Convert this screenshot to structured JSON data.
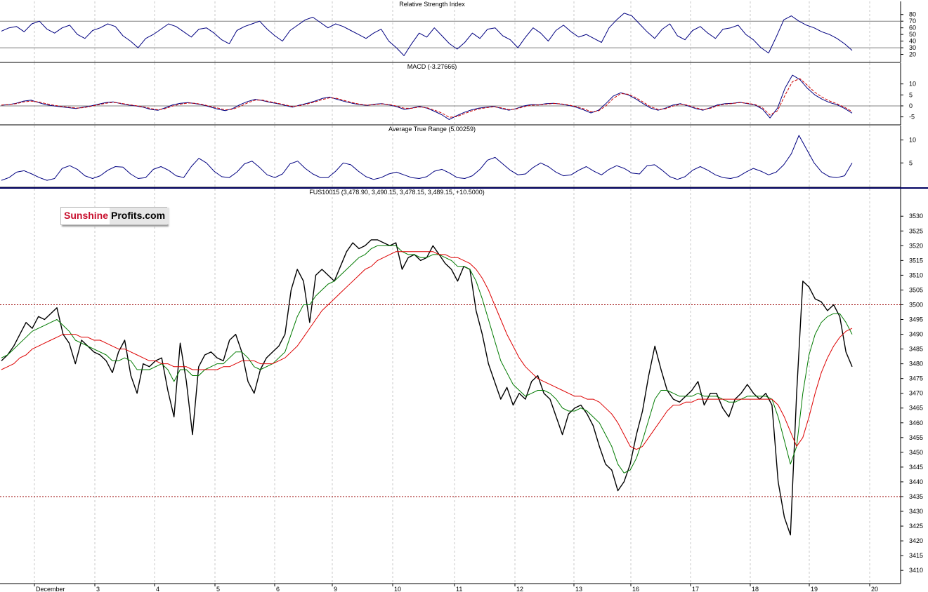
{
  "logo": {
    "part1": "Sunshine",
    "part2": "Profits.com"
  },
  "chart_data": [
    {
      "type": "line",
      "title": "Relative Strength Index",
      "ylim": [
        10,
        85
      ],
      "yticks": [
        80,
        70,
        60,
        50,
        40,
        30,
        20
      ],
      "reference_lines": [
        30,
        70
      ],
      "series": [
        {
          "name": "",
          "color": "#000080",
          "values": [
            55,
            60,
            62,
            54,
            66,
            70,
            58,
            52,
            60,
            64,
            50,
            44,
            56,
            60,
            66,
            62,
            48,
            40,
            30,
            44,
            50,
            58,
            66,
            62,
            54,
            46,
            58,
            60,
            52,
            42,
            36,
            56,
            62,
            66,
            70,
            58,
            48,
            40,
            56,
            64,
            72,
            76,
            68,
            60,
            66,
            62,
            56,
            50,
            44,
            52,
            58,
            40,
            30,
            18,
            36,
            52,
            46,
            60,
            48,
            36,
            28,
            38,
            52,
            44,
            58,
            60,
            48,
            42,
            30,
            46,
            60,
            52,
            40,
            56,
            64,
            54,
            46,
            50,
            44,
            38,
            60,
            72,
            82,
            78,
            66,
            54,
            44,
            58,
            66,
            48,
            42,
            56,
            62,
            52,
            44,
            58,
            60,
            64,
            50,
            42,
            30,
            22,
            46,
            72,
            78,
            70,
            64,
            60,
            54,
            50,
            44,
            36,
            26
          ]
        }
      ]
    },
    {
      "type": "line",
      "title": "MACD (-3.27666)",
      "ylim": [
        -8,
        15
      ],
      "yticks": [
        10,
        5,
        0,
        -5
      ],
      "reference_lines": [
        0
      ],
      "series": [
        {
          "name": "",
          "color": "#000080",
          "values": [
            0.3,
            0.6,
            1.2,
            2.2,
            2.6,
            1.5,
            0.5,
            0,
            -0.4,
            -0.8,
            -1.2,
            -0.6,
            0,
            0.8,
            1.5,
            1.8,
            1.0,
            0.4,
            0,
            -0.6,
            -1.6,
            -2.0,
            -0.8,
            0.5,
            1.2,
            1.5,
            1.0,
            0.4,
            -0.5,
            -1.5,
            -2.2,
            -1.2,
            0.6,
            2.0,
            3.0,
            2.4,
            1.6,
            1.0,
            0.2,
            -0.6,
            0.4,
            1.2,
            2.2,
            3.4,
            4.0,
            3.0,
            2.0,
            1.2,
            0.6,
            0.2,
            0.8,
            1.0,
            0.4,
            -0.4,
            -1.6,
            -1.0,
            -0.2,
            -1.0,
            -2.4,
            -4.0,
            -6.2,
            -4.5,
            -3.0,
            -1.8,
            -1.0,
            -0.6,
            -0.2,
            -1.2,
            -2.0,
            -1.2,
            0,
            0.6,
            0.5,
            1.0,
            1.2,
            0.8,
            0.2,
            -0.6,
            -1.8,
            -3.2,
            -2.0,
            1.0,
            4.5,
            6.0,
            5.0,
            3.2,
            1.0,
            -1.0,
            -2.0,
            -1.0,
            0.4,
            1.0,
            0,
            -1.2,
            -2.0,
            -0.8,
            0.5,
            1.0,
            1.2,
            1.6,
            1.0,
            0.4,
            -1.5,
            -5.5,
            -1.0,
            8.0,
            14.0,
            12.0,
            8.0,
            5.0,
            3.0,
            1.5,
            0.5,
            -1.2,
            -3.3
          ]
        },
        {
          "name": "",
          "color": "#cc0000",
          "values": [
            0.4,
            0.6,
            1.0,
            1.8,
            2.2,
            1.8,
            1.0,
            0.3,
            -0.2,
            -0.6,
            -1.0,
            -0.8,
            -0.2,
            0.5,
            1.2,
            1.6,
            1.2,
            0.6,
            0.1,
            -0.4,
            -1.2,
            -1.8,
            -1.2,
            0.0,
            0.8,
            1.3,
            1.2,
            0.6,
            -0.2,
            -1.0,
            -1.8,
            -1.5,
            -0.2,
            1.4,
            2.6,
            2.6,
            1.9,
            1.2,
            0.5,
            -0.3,
            0.1,
            0.9,
            1.8,
            2.9,
            3.7,
            3.4,
            2.4,
            1.5,
            0.8,
            0.3,
            0.6,
            0.9,
            0.6,
            -0.1,
            -1.1,
            -1.1,
            -0.5,
            -0.8,
            -1.9,
            -3.2,
            -5.2,
            -4.9,
            -3.6,
            -2.3,
            -1.4,
            -0.8,
            -0.4,
            -0.9,
            -1.7,
            -1.4,
            -0.4,
            0.3,
            0.4,
            0.8,
            1.1,
            0.9,
            0.4,
            -0.3,
            -1.3,
            -2.6,
            -2.3,
            0.0,
            3.4,
            5.6,
            5.3,
            3.8,
            1.7,
            -0.4,
            -1.6,
            -1.3,
            -0.1,
            0.8,
            0.3,
            -0.8,
            -1.7,
            -1.1,
            0.1,
            0.8,
            1.1,
            1.5,
            1.2,
            0.6,
            -0.9,
            -4.2,
            -2.2,
            4.8,
            11.0,
            12.4,
            9.4,
            6.2,
            3.9,
            2.2,
            0.9,
            -0.7,
            -2.6
          ]
        }
      ]
    },
    {
      "type": "line",
      "title": "Average True Range (5.00259)",
      "ylim": [
        0,
        11
      ],
      "yticks": [
        10,
        5
      ],
      "series": [
        {
          "name": "",
          "color": "#000080",
          "values": [
            1.2,
            1.8,
            3.0,
            3.3,
            2.6,
            1.8,
            1.2,
            1.6,
            3.8,
            4.4,
            3.6,
            2.2,
            1.6,
            2.2,
            3.4,
            4.2,
            4.1,
            2.6,
            1.6,
            1.8,
            3.6,
            4.2,
            3.4,
            2.2,
            1.8,
            4.2,
            6.0,
            5.0,
            3.2,
            2.0,
            1.8,
            3.0,
            4.8,
            5.4,
            4.0,
            2.4,
            1.8,
            2.6,
            4.8,
            5.4,
            3.8,
            2.6,
            1.8,
            1.8,
            3.2,
            5.0,
            4.6,
            3.2,
            2.0,
            1.4,
            1.8,
            2.6,
            3.0,
            2.4,
            1.8,
            1.6,
            2.0,
            3.2,
            3.6,
            2.8,
            1.8,
            1.6,
            2.2,
            3.6,
            5.6,
            6.2,
            4.8,
            3.4,
            2.4,
            2.6,
            4.0,
            5.0,
            4.2,
            3.0,
            2.2,
            2.4,
            3.4,
            4.2,
            3.2,
            2.4,
            3.6,
            4.4,
            3.8,
            2.8,
            2.6,
            4.4,
            4.6,
            3.4,
            2.0,
            1.4,
            2.0,
            3.4,
            4.2,
            3.4,
            2.4,
            1.8,
            1.6,
            2.0,
            3.0,
            3.8,
            3.2,
            2.4,
            3.0,
            4.6,
            7.0,
            11.0,
            8.0,
            5.0,
            3.0,
            2.0,
            1.8,
            2.2,
            5.0
          ]
        }
      ]
    },
    {
      "type": "line",
      "title": "FUS10015 (3,478.90, 3,490.15, 3,478.15, 3,489.15, +10.5000)",
      "ylim": [
        3406,
        3536
      ],
      "yticks": [
        3530,
        3525,
        3520,
        3515,
        3510,
        3505,
        3500,
        3495,
        3490,
        3485,
        3480,
        3475,
        3470,
        3465,
        3460,
        3455,
        3450,
        3445,
        3440,
        3435,
        3430,
        3425,
        3420,
        3415,
        3410
      ],
      "reference_lines": [
        3500,
        3435
      ],
      "x_labels": [
        "December",
        "3",
        "4",
        "5",
        "6",
        "9",
        "10",
        "11",
        "12",
        "13",
        "16",
        "17",
        "18",
        "19",
        "20"
      ],
      "series": [
        {
          "name": "",
          "color": "#000000",
          "values": [
            3481,
            3483,
            3486,
            3490,
            3494,
            3492,
            3496,
            3495,
            3497,
            3499,
            3490,
            3487,
            3480,
            3488,
            3486,
            3484,
            3483,
            3481,
            3477,
            3484,
            3488,
            3476,
            3470,
            3480,
            3479,
            3481,
            3482,
            3471,
            3462,
            3487,
            3474,
            3456,
            3479,
            3483,
            3484,
            3482,
            3481,
            3488,
            3490,
            3484,
            3474,
            3470,
            3478,
            3482,
            3484,
            3486,
            3490,
            3505,
            3512,
            3508,
            3494,
            3510,
            3512,
            3510,
            3508,
            3513,
            3518,
            3521,
            3519,
            3520,
            3522,
            3522,
            3521,
            3520,
            3521,
            3512,
            3516,
            3517,
            3515,
            3516,
            3520,
            3517,
            3514,
            3512,
            3508,
            3513,
            3512,
            3498,
            3490,
            3480,
            3474,
            3468,
            3472,
            3466,
            3470,
            3468,
            3474,
            3476,
            3470,
            3468,
            3462,
            3456,
            3463,
            3465,
            3466,
            3463,
            3459,
            3452,
            3446,
            3444,
            3437,
            3440,
            3446,
            3456,
            3464,
            3476,
            3486,
            3478,
            3471,
            3468,
            3467,
            3469,
            3471,
            3474,
            3466,
            3470,
            3470,
            3465,
            3462,
            3468,
            3470,
            3473,
            3470,
            3468,
            3470,
            3466,
            3440,
            3428,
            3422,
            3470,
            3508,
            3506,
            3502,
            3501,
            3498,
            3500,
            3496,
            3484,
            3479
          ]
        },
        {
          "name": "",
          "color": "#007a00",
          "values": [
            3482,
            3483,
            3485,
            3487,
            3489,
            3491,
            3492,
            3493,
            3494,
            3495,
            3493,
            3491,
            3488,
            3487,
            3486,
            3485,
            3484,
            3483,
            3481,
            3481,
            3482,
            3481,
            3478,
            3478,
            3478,
            3479,
            3480,
            3478,
            3474,
            3478,
            3478,
            3476,
            3476,
            3478,
            3479,
            3480,
            3480,
            3482,
            3484,
            3484,
            3482,
            3479,
            3478,
            3479,
            3480,
            3482,
            3484,
            3490,
            3496,
            3500,
            3500,
            3503,
            3505,
            3507,
            3508,
            3510,
            3512,
            3514,
            3516,
            3517,
            3519,
            3520,
            3520,
            3520,
            3520,
            3518,
            3517,
            3517,
            3516,
            3516,
            3517,
            3517,
            3516,
            3515,
            3513,
            3513,
            3512,
            3508,
            3502,
            3495,
            3488,
            3481,
            3477,
            3473,
            3471,
            3469,
            3470,
            3471,
            3471,
            3470,
            3468,
            3465,
            3464,
            3464,
            3465,
            3464,
            3462,
            3460,
            3456,
            3452,
            3446,
            3443,
            3444,
            3448,
            3454,
            3461,
            3468,
            3471,
            3471,
            3470,
            3469,
            3469,
            3469,
            3470,
            3469,
            3469,
            3469,
            3468,
            3467,
            3467,
            3468,
            3469,
            3469,
            3469,
            3469,
            3468,
            3462,
            3454,
            3446,
            3452,
            3470,
            3483,
            3490,
            3494,
            3496,
            3497,
            3497,
            3494,
            3490
          ]
        },
        {
          "name": "",
          "color": "#dd0000",
          "values": [
            3478,
            3479,
            3480,
            3482,
            3483,
            3485,
            3486,
            3487,
            3488,
            3489,
            3490,
            3490,
            3490,
            3489,
            3489,
            3488,
            3488,
            3487,
            3486,
            3485,
            3485,
            3484,
            3483,
            3482,
            3481,
            3481,
            3480,
            3480,
            3479,
            3479,
            3479,
            3478,
            3478,
            3478,
            3478,
            3478,
            3479,
            3479,
            3480,
            3481,
            3481,
            3481,
            3480,
            3480,
            3480,
            3481,
            3482,
            3484,
            3486,
            3489,
            3492,
            3495,
            3498,
            3500,
            3502,
            3504,
            3506,
            3508,
            3510,
            3512,
            3513,
            3515,
            3516,
            3517,
            3518,
            3518,
            3518,
            3518,
            3518,
            3518,
            3518,
            3517,
            3517,
            3516,
            3516,
            3515,
            3514,
            3512,
            3509,
            3505,
            3500,
            3495,
            3490,
            3486,
            3482,
            3479,
            3477,
            3475,
            3474,
            3473,
            3472,
            3471,
            3470,
            3469,
            3469,
            3468,
            3468,
            3467,
            3465,
            3463,
            3460,
            3456,
            3452,
            3451,
            3452,
            3455,
            3458,
            3461,
            3464,
            3466,
            3466,
            3467,
            3467,
            3468,
            3468,
            3468,
            3468,
            3468,
            3468,
            3468,
            3468,
            3468,
            3468,
            3468,
            3468,
            3468,
            3466,
            3462,
            3457,
            3452,
            3455,
            3462,
            3470,
            3477,
            3482,
            3486,
            3489,
            3491,
            3492
          ]
        }
      ]
    }
  ]
}
